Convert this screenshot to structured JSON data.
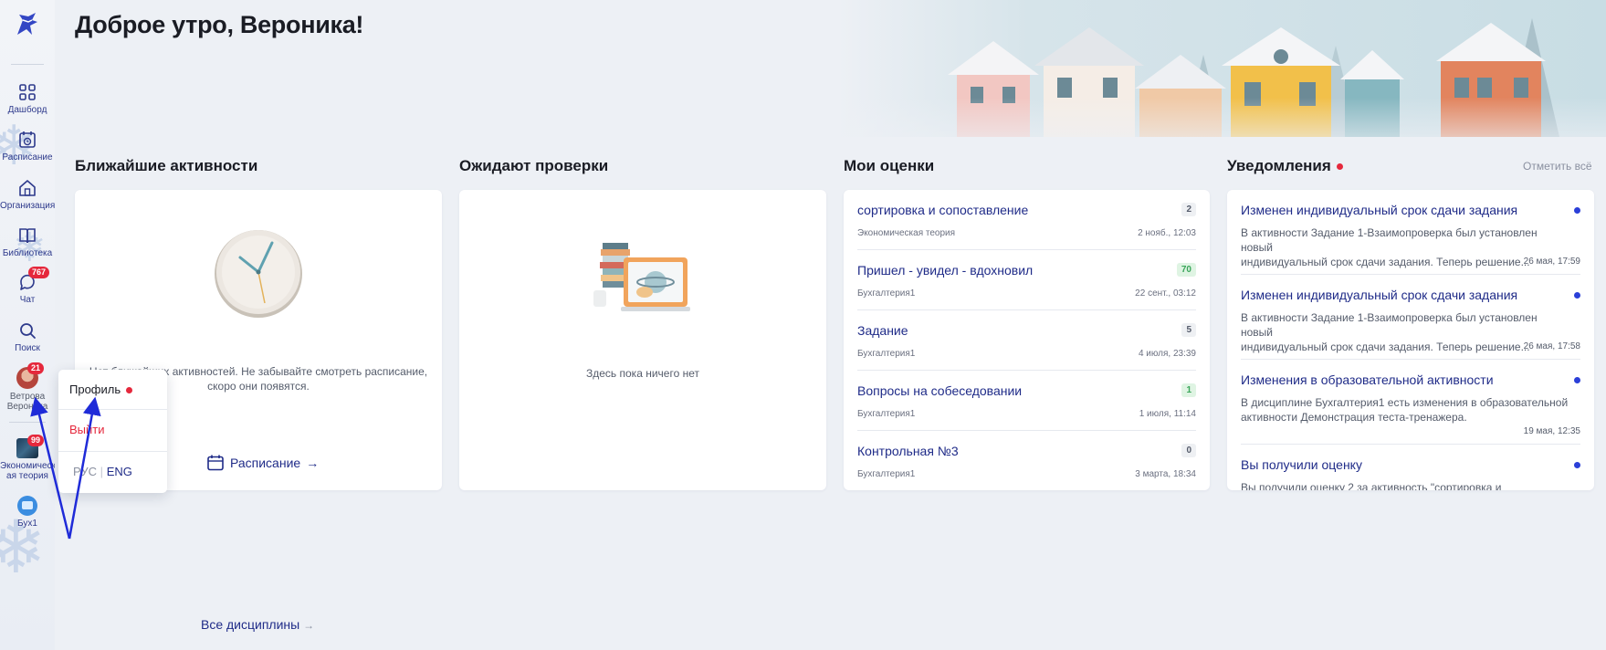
{
  "header": {
    "greeting": "Доброе утро, Вероника!"
  },
  "sidebar": {
    "items": [
      {
        "label": "Дашборд"
      },
      {
        "label": "Расписание"
      },
      {
        "label": "Организация"
      },
      {
        "label": "Библиотека"
      },
      {
        "label": "Чат",
        "badge": "767"
      },
      {
        "label": "Поиск"
      },
      {
        "label": "Ветрова Вероника",
        "label_line1": "Ветрова",
        "label_line2": "Вероника",
        "badge": "21"
      },
      {
        "label_line1": "Экономическ",
        "label_line2": "ая теория",
        "badge": "99"
      },
      {
        "label": "Бух1"
      }
    ]
  },
  "sections": {
    "activities": {
      "title": "Ближайшие активности",
      "empty_text_line1": "Нет ближайших активностей. Не забывайте смотреть расписание,",
      "empty_text_line2": "скоро они появятся.",
      "link": "Расписание"
    },
    "review": {
      "title": "Ожидают проверки",
      "empty_text": "Здесь пока ничего нет"
    },
    "grades": {
      "title": "Мои оценки",
      "rows": [
        {
          "title": "сортировка и сопоставление",
          "score": "2",
          "subject": "Экономическая теория",
          "date": "2 нояб., 12:03"
        },
        {
          "title": "Пришел - увидел - вдохновил",
          "score": "70",
          "subject": "Бухгалтерия1",
          "date": "22 сент., 03:12"
        },
        {
          "title": "Задание",
          "score": "5",
          "subject": "Бухгалтерия1",
          "date": "4 июля, 23:39"
        },
        {
          "title": "Вопросы на собеседовании",
          "score": "1",
          "subject": "Бухгалтерия1",
          "date": "1 июля, 11:14"
        },
        {
          "title": "Контрольная №3",
          "score": "0",
          "subject": "Бухгалтерия1",
          "date": "3 марта, 18:34"
        }
      ]
    },
    "notifications": {
      "title": "Уведомления",
      "mark_all": "Отметить всё",
      "items": [
        {
          "title": "Изменен индивидуальный срок сдачи задания",
          "body_line1": "В активности Задание 1-Взаимопроверка был установлен новый",
          "body_line2": "индивидуальный срок сдачи задания. Теперь решение...",
          "date": "26 мая, 17:59"
        },
        {
          "title": "Изменен индивидуальный срок сдачи задания",
          "body_line1": "В активности Задание 1-Взаимопроверка был установлен новый",
          "body_line2": "индивидуальный срок сдачи задания. Теперь решение...",
          "date": "26 мая, 17:58"
        },
        {
          "title": "Изменения в образовательной активности",
          "body_line1": "В дисциплине Бухгалтерия1 есть изменения в образовательной",
          "body_line2": "активности Демонстрация теста-тренажера.",
          "date": "19 мая, 12:35"
        },
        {
          "title": "Вы получили оценку",
          "body_line1": "Вы получили оценку 2 за активность \"сортировка и",
          "body_line2": "",
          "date": ""
        }
      ]
    }
  },
  "all_disciplines": "Все дисциплины",
  "popup": {
    "profile": "Профиль",
    "logout": "Выйти",
    "lang_ru": "РУС",
    "lang_sep": "|",
    "lang_en": "ENG"
  },
  "colors": {
    "accent": "#1f2b88",
    "badge": "#e5283c",
    "unread_dot": "#2b3fd8",
    "good_score": "#3aa55a"
  }
}
